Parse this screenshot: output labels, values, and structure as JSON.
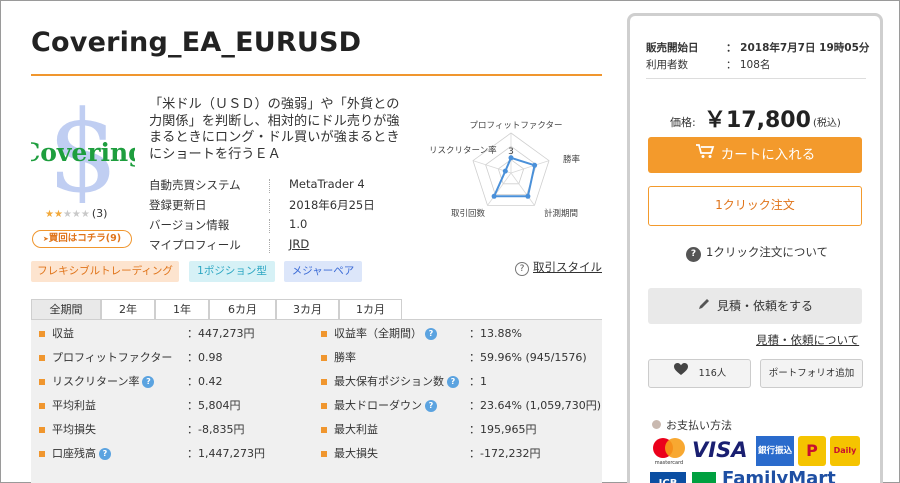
{
  "product": {
    "title": "Covering_EA_EURUSD",
    "logo_text": "Covering",
    "rating_count": "(3)",
    "buy_here": "買回はコチラ(9)",
    "description": "「米ドル（ＵＳＤ）の強弱」や「外貨との力関係」を判断し、相対的にドル売りが強まるときにロング・ドル買いが強まるときにショートを行うＥＡ"
  },
  "info": [
    {
      "label": "自動売買システム",
      "value": "MetaTrader 4"
    },
    {
      "label": "登録更新日",
      "value": "2018年6月25日"
    },
    {
      "label": "バージョン情報",
      "value": "1.0"
    },
    {
      "label": "マイプロフィール",
      "value": "JRD"
    }
  ],
  "tags": [
    "フレキシブルトレーディング",
    "1ポジション型",
    "メジャーペア"
  ],
  "style_help": "取引スタイル",
  "radar": {
    "labels": [
      "プロフィットファクター",
      "勝率",
      "計測期間",
      "取引回数",
      "リスクリターン率"
    ],
    "scale_label": "3",
    "values": [
      0.38,
      0.62,
      0.72,
      0.72,
      0.15
    ]
  },
  "tabs": [
    "全期間",
    "2年",
    "1年",
    "6カ月",
    "3カ月",
    "1カ月"
  ],
  "stats_left": [
    {
      "label": "収益",
      "value": "：447,273円"
    },
    {
      "label": "プロフィットファクター",
      "value": "：0.98"
    },
    {
      "label": "リスクリターン率",
      "value": "：0.42"
    },
    {
      "label": "平均利益",
      "value": "：5,804円"
    },
    {
      "label": "平均損失",
      "value": "：-8,835円"
    },
    {
      "label": "口座残高",
      "value": "：1,447,273円"
    }
  ],
  "stats_right": [
    {
      "label": "収益率（全期間）",
      "value": "：13.88%"
    },
    {
      "label": "勝率",
      "value": "：59.96% (945/1576)"
    },
    {
      "label": "最大保有ポジション数",
      "value": "：1"
    },
    {
      "label": "最大ドローダウン",
      "value": "：23.64% (1,059,730円)"
    },
    {
      "label": "最大利益",
      "value": "：195,965円"
    },
    {
      "label": "最大損失",
      "value": "：-172,232円"
    }
  ],
  "panel": {
    "release_label": "販売開始日",
    "release_value": "：  2018年7月7日 19時05分",
    "users_label": "利用者数",
    "users_value": "：  108名",
    "price_label": "価格:",
    "price_value": "￥17,800",
    "price_tax": "(税込)",
    "cart_label": "カートに入れる",
    "oneclick_label": "1クリック注文",
    "oneclick_help": "1クリック注文について",
    "quote_label": "見積・依頼をする",
    "quote_link": "見積・依頼について",
    "fav_count": "116人",
    "portfolio_label": "ポートフォリオ追加",
    "payment_title": "お支払い方法",
    "mastercard": "mastercard",
    "visa": "VISA",
    "bank": "銀行振込",
    "payeasy": "P",
    "daily": "Daily",
    "jcb": "JCB",
    "familymart": "FamilyMart"
  },
  "colors": {
    "accent": "#f39a2c",
    "radar_line": "#4a90d9",
    "help_icon": "#5ba3e0"
  }
}
